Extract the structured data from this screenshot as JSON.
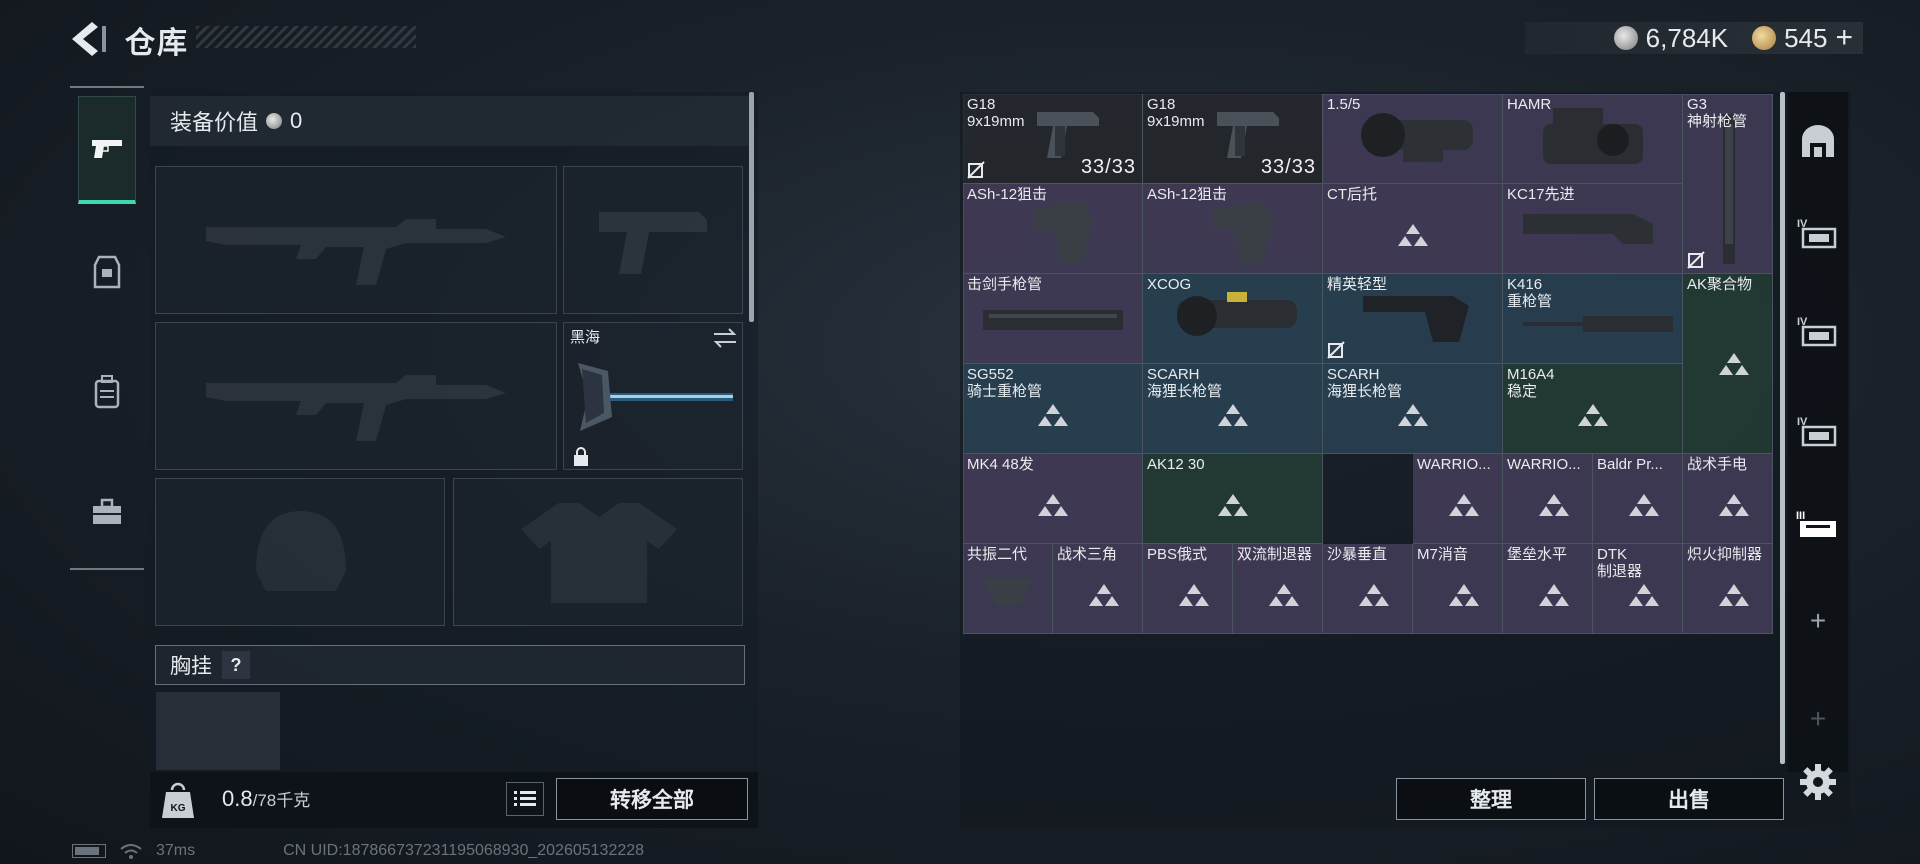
{
  "header": {
    "title": "仓库",
    "currency_silver": "6,784K",
    "currency_gold": "545",
    "currency_add": "+"
  },
  "equipment": {
    "value_label": "装备价值",
    "value": "0",
    "melee_name": "黑海",
    "chest_label": "胸挂",
    "chest_help": "?",
    "weight_current": "0.8",
    "weight_max": "/78千克",
    "transfer_all": "转移全部"
  },
  "status": {
    "ping": "37ms",
    "uid": "CN UID:187866737231195068930_202605132228"
  },
  "storage": {
    "items": [
      {
        "name": "G18",
        "sub": "9x19mm",
        "count": "33/33"
      },
      {
        "name": "G18",
        "sub": "9x19mm",
        "count": "33/33"
      },
      {
        "name": "1.5/5",
        "sub": ""
      },
      {
        "name": "HAMR",
        "sub": ""
      },
      {
        "name": "G3",
        "sub": "神射枪管"
      },
      {
        "name": "ASh-12狙击",
        "sub": ""
      },
      {
        "name": "ASh-12狙击",
        "sub": ""
      },
      {
        "name": "CT后托",
        "sub": ""
      },
      {
        "name": "KC17先进",
        "sub": ""
      },
      {
        "name": "击剑手枪管",
        "sub": ""
      },
      {
        "name": "XCOG",
        "sub": ""
      },
      {
        "name": "精英轻型",
        "sub": ""
      },
      {
        "name": "K416",
        "sub": "重枪管"
      },
      {
        "name": "AK聚合物",
        "sub": ""
      },
      {
        "name": "SG552",
        "sub": "骑士重枪管"
      },
      {
        "name": "SCARH",
        "sub": "海狸长枪管"
      },
      {
        "name": "SCARH",
        "sub": "海狸长枪管"
      },
      {
        "name": "M16A4",
        "sub": "稳定"
      },
      {
        "name": "MK4 48发",
        "sub": ""
      },
      {
        "name": "AK12 30",
        "sub": ""
      },
      {
        "name": "WARRIO...",
        "sub": ""
      },
      {
        "name": "WARRIO...",
        "sub": ""
      },
      {
        "name": "Baldr Pr...",
        "sub": ""
      },
      {
        "name": "战术手电",
        "sub": ""
      },
      {
        "name": "共振二代",
        "sub": ""
      },
      {
        "name": "战术三角",
        "sub": ""
      },
      {
        "name": "PBS俄式",
        "sub": ""
      },
      {
        "name": "双流制退器",
        "sub": ""
      },
      {
        "name": "沙暴垂直",
        "sub": ""
      },
      {
        "name": "M7消音",
        "sub": ""
      },
      {
        "name": "堡垒水平",
        "sub": ""
      },
      {
        "name": "DTK",
        "sub": "制退器"
      },
      {
        "name": "炽火抑制器",
        "sub": ""
      }
    ],
    "sort_label": "整理",
    "sell_label": "出售"
  },
  "colors": {
    "accent": "#3fd6b0",
    "rarity_purple": "#49405f",
    "rarity_blue": "#2c465a",
    "rarity_green": "#243e36"
  }
}
